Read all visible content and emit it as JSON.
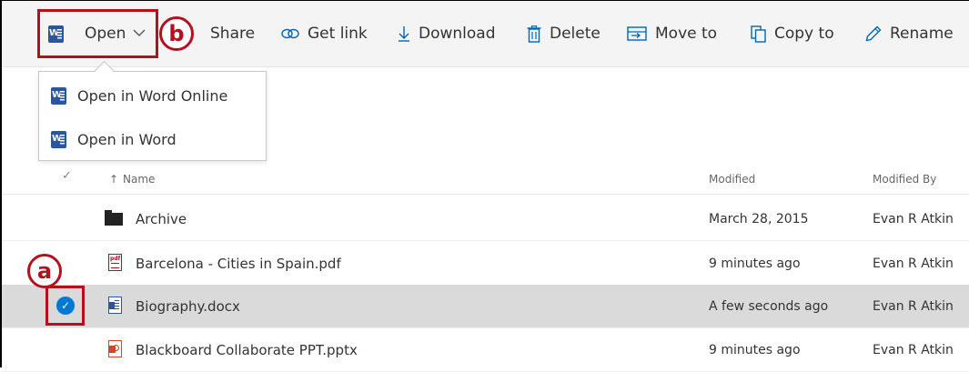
{
  "toolbar": {
    "open_label": "Open",
    "share_label": "Share",
    "get_link_label": "Get link",
    "download_label": "Download",
    "delete_label": "Delete",
    "move_to_label": "Move to",
    "copy_to_label": "Copy to",
    "rename_label": "Rename"
  },
  "open_menu": {
    "items": [
      {
        "label": "Open in Word Online",
        "icon": "word-icon"
      },
      {
        "label": "Open in Word",
        "icon": "word-icon"
      }
    ]
  },
  "callouts": {
    "a": "a",
    "b": "b"
  },
  "list": {
    "columns": {
      "check": "✓",
      "name": "Name",
      "sort_arrow": "↑",
      "modified": "Modified",
      "modified_by": "Modified By"
    },
    "rows": [
      {
        "name": "Archive",
        "type": "folder",
        "modified": "March 28, 2015",
        "modified_by": "Evan R Atkin",
        "selected": false
      },
      {
        "name": "Barcelona - Cities in Spain.pdf",
        "type": "pdf",
        "modified": "9 minutes ago",
        "modified_by": "Evan R Atkin",
        "selected": false
      },
      {
        "name": "Biography.docx",
        "type": "docx",
        "modified": "A few seconds ago",
        "modified_by": "Evan R Atkin",
        "selected": true
      },
      {
        "name": "Blackboard Collaborate PPT.pptx",
        "type": "pptx",
        "modified": "9 minutes ago",
        "modified_by": "Evan R Atkin",
        "selected": false
      }
    ]
  },
  "colors": {
    "accent": "#0078d4",
    "callout_red": "#b4101e",
    "selected_row": "#dadada",
    "command_bar": "#f4f4f4"
  }
}
